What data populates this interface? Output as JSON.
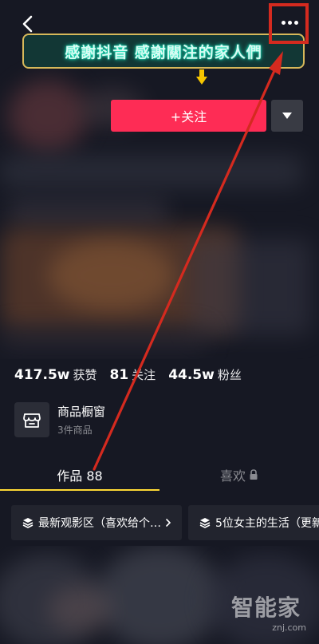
{
  "header": {
    "back_icon": "chevron-left-icon",
    "more_icon": "more-horizontal-icon",
    "banner_text": "感謝抖音 感謝關注的家人們"
  },
  "profile_actions": {
    "follow_label": "+关注",
    "dropdown_icon": "caret-down-icon"
  },
  "stats": [
    {
      "value": "417.5w",
      "label": "获赞"
    },
    {
      "value": "81",
      "label": "关注"
    },
    {
      "value": "44.5w",
      "label": "粉丝"
    }
  ],
  "shop": {
    "icon": "shop-window-icon",
    "title": "商品橱窗",
    "subtitle": "3件商品"
  },
  "tabs": [
    {
      "label": "作品 88",
      "active": true
    },
    {
      "label": "喜欢",
      "active": false,
      "icon": "lock-icon"
    }
  ],
  "collections": [
    {
      "label": "最新观影区（喜欢给个…",
      "icon": "layers-icon",
      "has_chevron": true
    },
    {
      "label": "5位女主的生活（更新",
      "icon": "layers-icon",
      "has_chevron": false
    }
  ],
  "watermark": {
    "text": "智能家",
    "sub": "znj.com"
  },
  "colors": {
    "background": "#161823",
    "follow_button": "#fe2c55",
    "tab_indicator": "#fdd835",
    "annotation": "#d42a1f"
  }
}
